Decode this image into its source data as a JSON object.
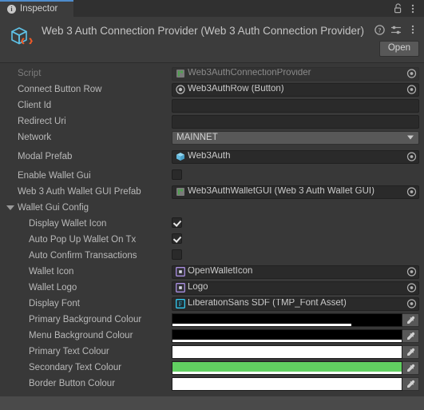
{
  "window": {
    "tab": {
      "label": "Inspector",
      "icon": "info-icon"
    },
    "tab_accent": "#4e8ccc",
    "lock_icon": "lock-open-icon",
    "menu_icon": "kebab-menu-icon"
  },
  "header": {
    "title": "Web 3 Auth Connection Provider (Web 3 Auth Connection Provider)",
    "icon": "cs-script-cube-icon",
    "help_icon": "help-icon",
    "preset_icon": "preset-sliders-icon",
    "menu_icon": "kebab-menu-icon",
    "open_label": "Open"
  },
  "properties": [
    {
      "name": "script",
      "label": "Script",
      "type": "object",
      "value": "Web3AuthConnectionProvider",
      "icon": "cs-script-icon",
      "disabled": true
    },
    {
      "name": "connect-button-row",
      "label": "Connect Button Row",
      "type": "object",
      "value": "Web3AuthRow (Button)",
      "icon": "button-component-icon",
      "disabled": false
    },
    {
      "name": "client-id",
      "label": "Client Id",
      "type": "text",
      "value": "",
      "placeholder": ""
    },
    {
      "name": "redirect-uri",
      "label": "Redirect Uri",
      "type": "text",
      "value": "",
      "placeholder": ""
    },
    {
      "name": "network",
      "label": "Network",
      "type": "dropdown",
      "value": "MAINNET",
      "options": [
        "MAINNET"
      ]
    },
    {
      "name": "modal-prefab",
      "label": "Modal Prefab",
      "type": "object",
      "value": "Web3Auth",
      "icon": "prefab-cube-icon",
      "gap_above": true
    },
    {
      "name": "enable-wallet-gui",
      "label": "Enable Wallet Gui",
      "type": "checkbox",
      "checked": false,
      "gap_above": true
    },
    {
      "name": "web3auth-wallet-gui-prefab",
      "label": "Web 3 Auth Wallet GUI Prefab",
      "type": "object",
      "value": "Web3AuthWalletGUI (Web 3 Auth Wallet GUI)",
      "icon": "cs-script-icon"
    }
  ],
  "wallet_gui_config": {
    "label": "Wallet Gui Config",
    "expanded": true,
    "properties": [
      {
        "name": "display-wallet-icon",
        "label": "Display Wallet Icon",
        "type": "checkbox",
        "checked": true
      },
      {
        "name": "auto-pop-up-wallet-on-tx",
        "label": "Auto Pop Up Wallet On Tx",
        "type": "checkbox",
        "checked": true
      },
      {
        "name": "auto-confirm-transactions",
        "label": "Auto Confirm Transactions",
        "type": "checkbox",
        "checked": false
      },
      {
        "name": "wallet-icon",
        "label": "Wallet Icon",
        "type": "object",
        "value": "OpenWalletIcon",
        "icon": "sprite-icon"
      },
      {
        "name": "wallet-logo",
        "label": "Wallet Logo",
        "type": "object",
        "value": "Logo",
        "icon": "sprite-icon"
      },
      {
        "name": "display-font",
        "label": "Display Font",
        "type": "object",
        "value": "LiberationSans SDF (TMP_Font Asset)",
        "icon": "font-asset-icon"
      },
      {
        "name": "primary-background-colour",
        "label": "Primary Background Colour",
        "type": "color",
        "color": "#000000",
        "alpha": 0.78
      },
      {
        "name": "menu-background-colour",
        "label": "Menu Background Colour",
        "type": "color",
        "color": "#000000",
        "alpha": 1.0
      },
      {
        "name": "primary-text-colour",
        "label": "Primary Text Colour",
        "type": "color",
        "color": "#FFFFFF",
        "alpha": 1.0
      },
      {
        "name": "secondary-text-colour",
        "label": "Secondary Text Colour",
        "type": "color",
        "color": "#61D061",
        "alpha": 1.0
      },
      {
        "name": "border-button-colour",
        "label": "Border Button Colour",
        "type": "color",
        "color": "#FFFFFF",
        "alpha": 1.0
      }
    ]
  }
}
